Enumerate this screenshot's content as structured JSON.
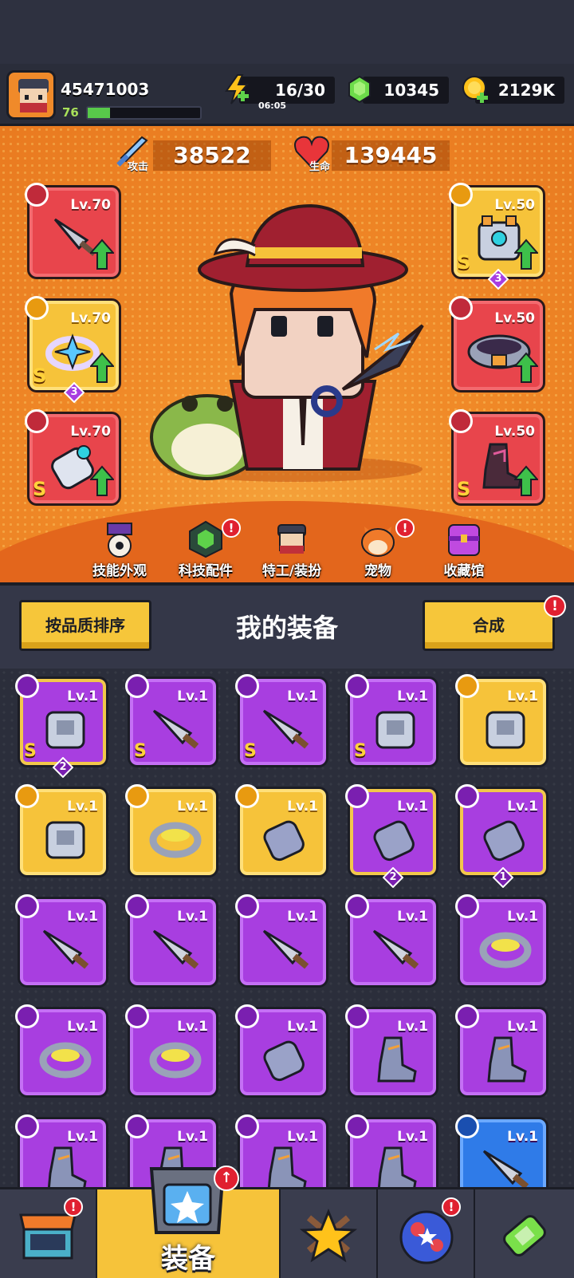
{
  "player": {
    "id": "45471003",
    "level": "76",
    "xp_fraction": 0.2
  },
  "resources": {
    "energy": {
      "value": "16/30",
      "timer": "06:05",
      "icon": "lightning-icon"
    },
    "gems": {
      "value": "10345",
      "icon": "gem-icon"
    },
    "coins": {
      "value": "2129K",
      "icon": "coin-icon"
    }
  },
  "stats": {
    "attack": {
      "label": "攻击",
      "value": "38522"
    },
    "hp": {
      "label": "生命",
      "value": "139445"
    }
  },
  "equipped": {
    "weapon": {
      "level": "Lv.70",
      "grade": ""
    },
    "necklace": {
      "level": "Lv.70",
      "grade": "S",
      "stars": "3"
    },
    "gloves": {
      "level": "Lv.70",
      "grade": "S"
    },
    "armor": {
      "level": "Lv.50",
      "grade": "S",
      "stars": "3"
    },
    "belt": {
      "level": "Lv.50",
      "grade": ""
    },
    "boots": {
      "level": "Lv.50",
      "grade": "S"
    }
  },
  "hero_nav": [
    {
      "label": "技能外观",
      "alert": false
    },
    {
      "label": "科技配件",
      "alert": true
    },
    {
      "label": "特工/装扮",
      "alert": false
    },
    {
      "label": "宠物",
      "alert": true
    },
    {
      "label": "收藏馆",
      "alert": false
    }
  ],
  "toolbar": {
    "sort_label": "按品质排序",
    "title": "我的装备",
    "merge_label": "合成",
    "alert": "!"
  },
  "inventory": [
    {
      "level": "Lv.1",
      "grade": "S",
      "stars": "2",
      "color": "purple-gold",
      "slot": "armor"
    },
    {
      "level": "Lv.1",
      "grade": "S",
      "stars": "",
      "color": "purple",
      "slot": "weapon"
    },
    {
      "level": "Lv.1",
      "grade": "S",
      "stars": "",
      "color": "purple",
      "slot": "weapon"
    },
    {
      "level": "Lv.1",
      "grade": "S",
      "stars": "",
      "color": "purple",
      "slot": "armor"
    },
    {
      "level": "Lv.1",
      "grade": "",
      "stars": "",
      "color": "gold",
      "slot": "armor"
    },
    {
      "level": "Lv.1",
      "grade": "",
      "stars": "",
      "color": "gold",
      "slot": "armor"
    },
    {
      "level": "Lv.1",
      "grade": "",
      "stars": "",
      "color": "gold",
      "slot": "necklace"
    },
    {
      "level": "Lv.1",
      "grade": "",
      "stars": "",
      "color": "gold",
      "slot": "gloves"
    },
    {
      "level": "Lv.1",
      "grade": "",
      "stars": "2",
      "color": "purple-gold",
      "slot": "gloves"
    },
    {
      "level": "Lv.1",
      "grade": "",
      "stars": "1",
      "color": "purple-gold",
      "slot": "gloves"
    },
    {
      "level": "Lv.1",
      "grade": "",
      "stars": "",
      "color": "purple",
      "slot": "weapon"
    },
    {
      "level": "Lv.1",
      "grade": "",
      "stars": "",
      "color": "purple",
      "slot": "weapon"
    },
    {
      "level": "Lv.1",
      "grade": "",
      "stars": "",
      "color": "purple",
      "slot": "weapon"
    },
    {
      "level": "Lv.1",
      "grade": "",
      "stars": "",
      "color": "purple",
      "slot": "weapon"
    },
    {
      "level": "Lv.1",
      "grade": "",
      "stars": "",
      "color": "purple",
      "slot": "necklace"
    },
    {
      "level": "Lv.1",
      "grade": "",
      "stars": "",
      "color": "purple",
      "slot": "necklace"
    },
    {
      "level": "Lv.1",
      "grade": "",
      "stars": "",
      "color": "purple",
      "slot": "necklace"
    },
    {
      "level": "Lv.1",
      "grade": "",
      "stars": "",
      "color": "purple",
      "slot": "gloves"
    },
    {
      "level": "Lv.1",
      "grade": "",
      "stars": "",
      "color": "purple",
      "slot": "boots"
    },
    {
      "level": "Lv.1",
      "grade": "",
      "stars": "",
      "color": "purple",
      "slot": "boots"
    },
    {
      "level": "Lv.1",
      "grade": "",
      "stars": "",
      "color": "purple",
      "slot": "boots"
    },
    {
      "level": "Lv.1",
      "grade": "",
      "stars": "",
      "color": "purple",
      "slot": "boots"
    },
    {
      "level": "Lv.1",
      "grade": "",
      "stars": "",
      "color": "purple",
      "slot": "boots"
    },
    {
      "level": "Lv.1",
      "grade": "",
      "stars": "",
      "color": "purple",
      "slot": "boots"
    },
    {
      "level": "Lv.1",
      "grade": "",
      "stars": "",
      "color": "blue",
      "slot": "weapon"
    }
  ],
  "bottom_nav": [
    {
      "name": "shop",
      "label": "",
      "icon": "shop-icon",
      "alert": true
    },
    {
      "name": "equipment",
      "label": "装备",
      "icon": "equipment-icon",
      "alert": true,
      "active": true
    },
    {
      "name": "battle",
      "label": "",
      "icon": "battle-icon",
      "alert": false
    },
    {
      "name": "planet",
      "label": "",
      "icon": "planet-icon",
      "alert": true
    },
    {
      "name": "lab",
      "label": "",
      "icon": "lab-icon",
      "alert": false
    }
  ]
}
